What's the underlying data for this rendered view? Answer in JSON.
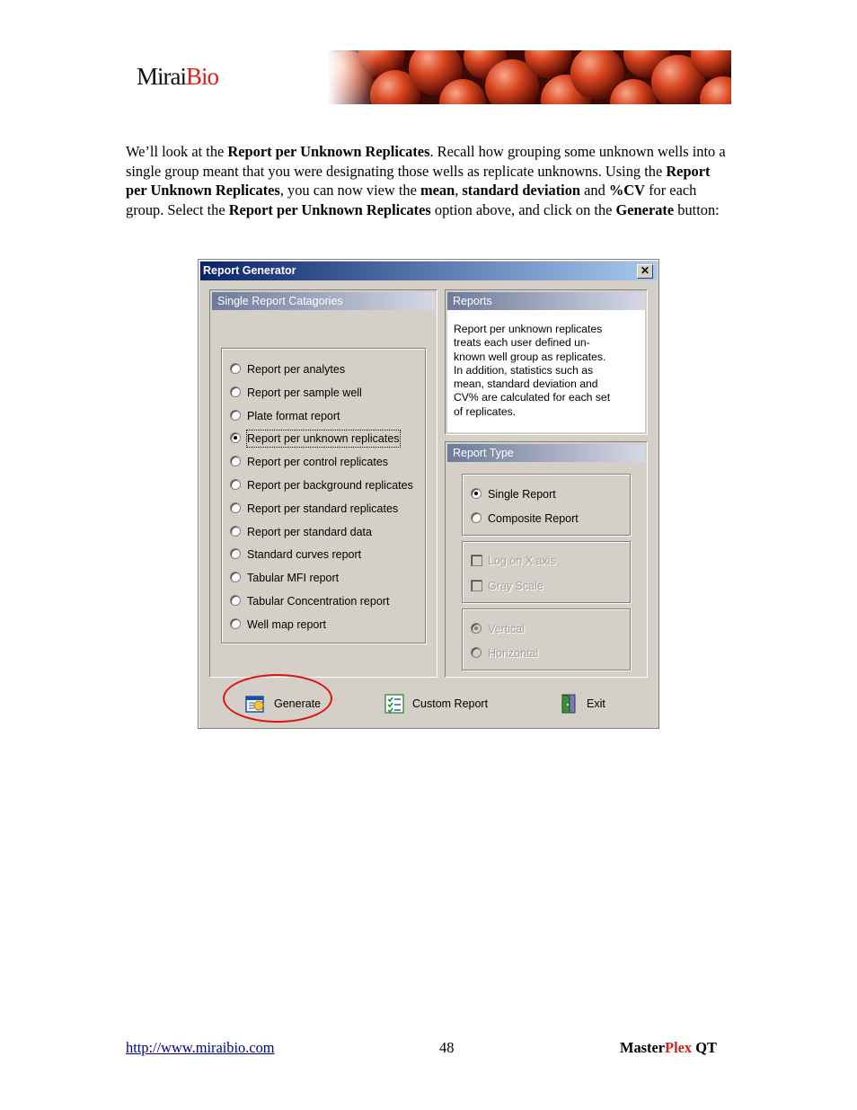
{
  "header": {
    "logo_main": "Mirai",
    "logo_accent": "Bio"
  },
  "intro": {
    "p1": "We’ll look at the ",
    "b1": "Report per Unknown Replicates",
    "p2": ".  Recall how grouping some unknown wells into a single group meant that you were designating those wells as replicate unknowns.  Using the ",
    "b2": "Report per Unknown Replicates",
    "p3": ", you can now view the ",
    "b3": "mean",
    "p4": ", ",
    "b4": "standard deviation",
    "p5": " and ",
    "b5": "%CV",
    "p6": " for each group.  Select the ",
    "b6": "Report per Unknown Replicates",
    "p7": " option above, and click on the ",
    "b7": "Generate",
    "p8": " button:"
  },
  "dialog": {
    "title": "Report Generator",
    "close": "✕",
    "categories_header": "Single Report Catagories",
    "categories": [
      {
        "label": "Report per analytes",
        "selected": false
      },
      {
        "label": "Report per sample well",
        "selected": false
      },
      {
        "label": "Plate format report",
        "selected": false
      },
      {
        "label": "Report per unknown replicates",
        "selected": true
      },
      {
        "label": "Report per control replicates",
        "selected": false
      },
      {
        "label": "Report per background replicates",
        "selected": false
      },
      {
        "label": "Report per standard replicates",
        "selected": false
      },
      {
        "label": "Report per standard data",
        "selected": false
      },
      {
        "label": "Standard curves report",
        "selected": false
      },
      {
        "label": "Tabular MFI report",
        "selected": false
      },
      {
        "label": "Tabular Concentration report",
        "selected": false
      },
      {
        "label": "Well map report",
        "selected": false
      }
    ],
    "reports_header": "Reports",
    "reports_description": [
      "Report per unknown replicates",
      "treats each user defined un-",
      "known well group as replicates.",
      "In addition, statistics such as",
      "mean, standard deviation and",
      "CV% are calculated for each set",
      "of replicates."
    ],
    "report_type_header": "Report Type",
    "report_type": {
      "single": "Single Report",
      "composite": "Composite Report",
      "selected": "single"
    },
    "chart_options": {
      "log_x": "Log on X axis",
      "gray_scale": "Gray Scale"
    },
    "orientation": {
      "vertical": "Vertical",
      "horizontal": "Horizontal",
      "selected": "vertical"
    },
    "buttons": {
      "generate": "Generate",
      "custom": "Custom Report",
      "exit": "Exit"
    }
  },
  "footer": {
    "url": "http://www.miraibio.com",
    "page": "48",
    "brand_a": "Master",
    "brand_b": "Plex",
    "brand_c": " QT"
  },
  "colors": {
    "accent_red": "#d4211a",
    "title_bar": "#0a246a",
    "highlight_circle": "#e21212"
  }
}
